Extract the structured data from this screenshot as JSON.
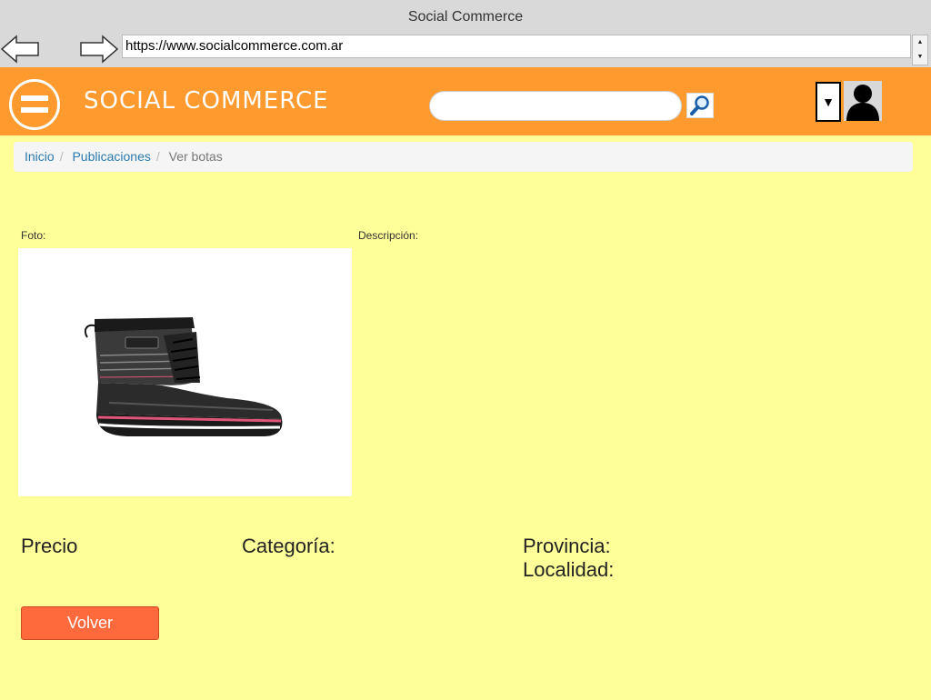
{
  "browser": {
    "window_title": "Social Commerce",
    "url": "https://www.socialcommerce.com.ar",
    "back_icon": "arrow-left-icon",
    "forward_icon": "arrow-right-icon"
  },
  "header": {
    "brand": "SOCIAL COMMERCE",
    "menu_icon": "hamburger-icon",
    "search_placeholder": "",
    "search_icon": "magnifier-icon",
    "dropdown_glyph": "▼",
    "avatar_icon": "user-silhouette-icon",
    "accent_color": "#ff9a2e"
  },
  "breadcrumb": {
    "items": [
      {
        "label": "Inicio"
      },
      {
        "label": "Publicaciones"
      }
    ],
    "current": "Ver botas"
  },
  "product": {
    "photo_label": "Foto:",
    "description_label": "Descripción:",
    "image_name": "boot-photo",
    "price_label": "Precio",
    "category_label": "Categoría:",
    "province_label": "Provincia:",
    "locality_label": "Localidad:"
  },
  "actions": {
    "back_button": "Volver"
  },
  "colors": {
    "page_bg": "#ffff99",
    "button_bg": "#ff6a3d"
  }
}
